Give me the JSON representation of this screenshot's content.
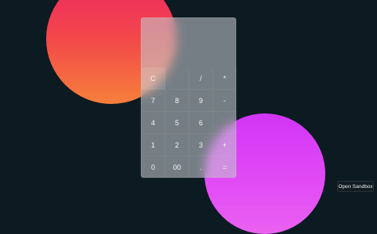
{
  "calculator": {
    "display": "",
    "keys": [
      {
        "label": "C",
        "name": "key-clear"
      },
      {
        "label": "",
        "name": "key-empty"
      },
      {
        "label": "/",
        "name": "key-divide"
      },
      {
        "label": "*",
        "name": "key-multiply"
      },
      {
        "label": "7",
        "name": "key-7"
      },
      {
        "label": "8",
        "name": "key-8"
      },
      {
        "label": "9",
        "name": "key-9"
      },
      {
        "label": "-",
        "name": "key-minus"
      },
      {
        "label": "4",
        "name": "key-4"
      },
      {
        "label": "5",
        "name": "key-5"
      },
      {
        "label": "6",
        "name": "key-6"
      },
      {
        "label": "",
        "name": "key-empty"
      },
      {
        "label": "1",
        "name": "key-1"
      },
      {
        "label": "2",
        "name": "key-2"
      },
      {
        "label": "3",
        "name": "key-3"
      },
      {
        "label": "+",
        "name": "key-plus"
      },
      {
        "label": "0",
        "name": "key-0"
      },
      {
        "label": "00",
        "name": "key-00"
      },
      {
        "label": ".",
        "name": "key-decimal"
      },
      {
        "label": "=",
        "name": "key-equals"
      }
    ]
  },
  "sandbox_button": {
    "label": "Open Sandbox"
  },
  "colors": {
    "background": "#0c1a22",
    "orb_red_top": "#ef2563",
    "orb_red_bottom": "#f7803c",
    "orb_magenta": "#d235f6"
  }
}
